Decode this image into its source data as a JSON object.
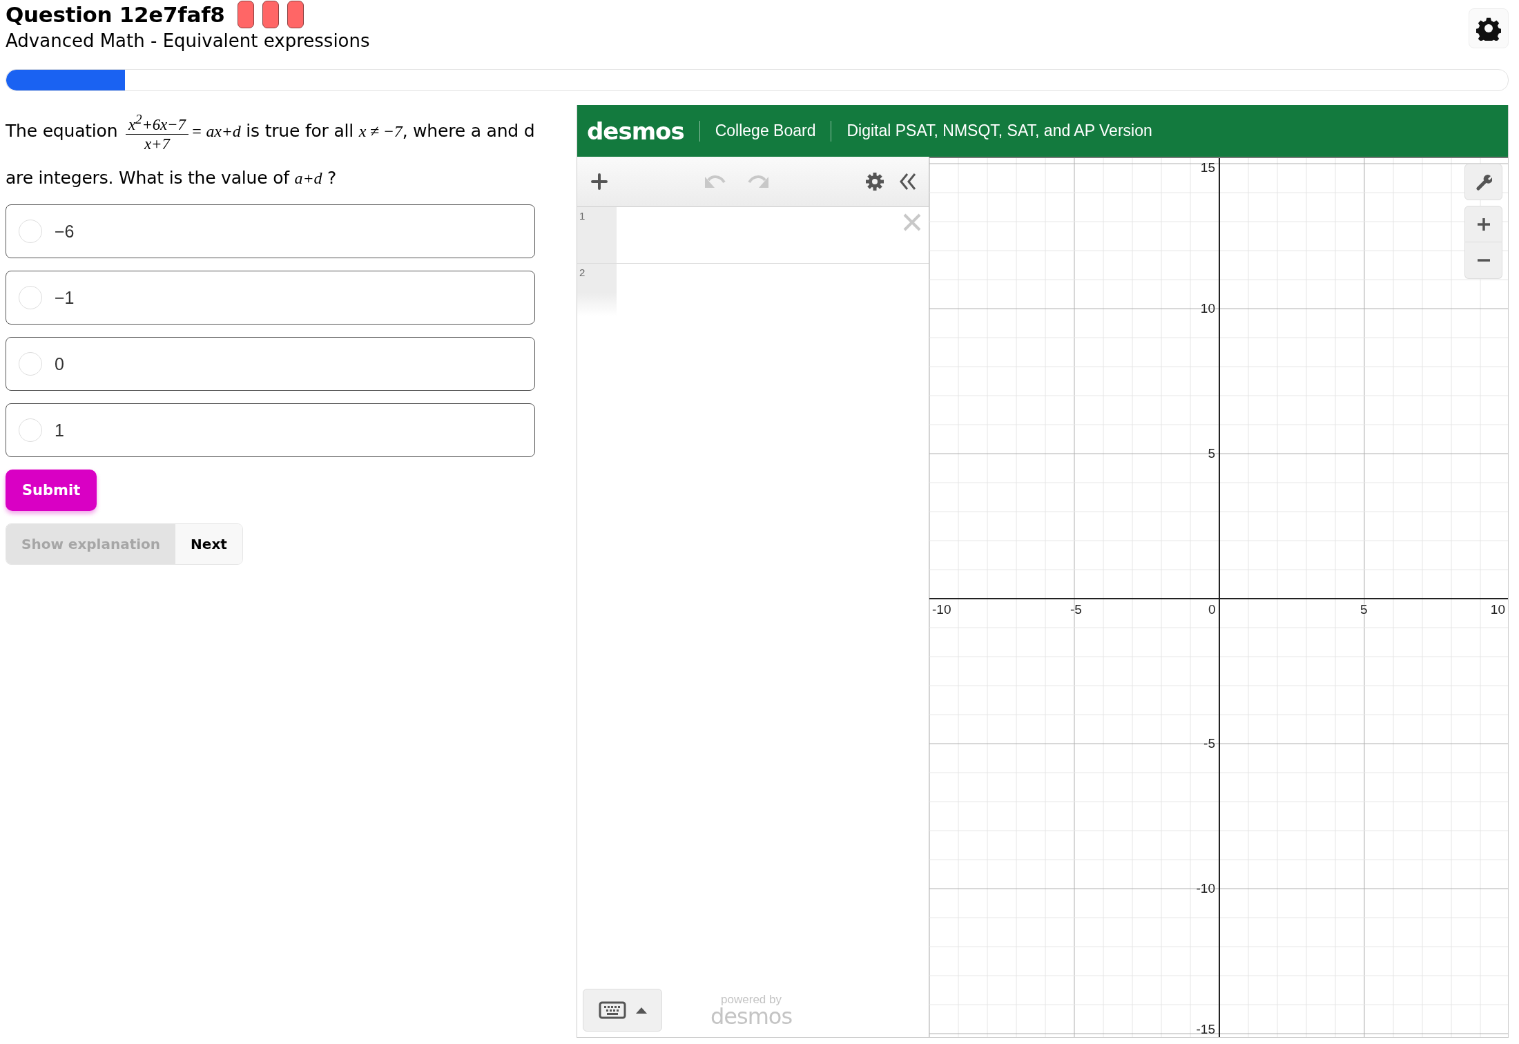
{
  "header": {
    "title": "Question 12e7faf8",
    "markers": [
      {
        "color": "#ff6666"
      },
      {
        "color": "#ff6666"
      },
      {
        "color": "#ff6666"
      }
    ],
    "subtitle": "Advanced Math - Equivalent expressions"
  },
  "progress": {
    "level": 0.079
  },
  "question": [
    {
      "kind": "text",
      "text": "The equation "
    },
    {
      "kind": "fraction",
      "numerator": "x$^{2}$+6x−7",
      "denominator": "x+7"
    },
    {
      "kind": "math",
      "text": "= ax+d"
    },
    {
      "kind": "text",
      "text": " is true for all "
    },
    {
      "kind": "math",
      "text": "x ≠ −7"
    },
    {
      "kind": "text",
      "text": ", where a and d are integers. What is the value of "
    },
    {
      "kind": "math",
      "text": "a+d"
    },
    {
      "kind": "text",
      "text": " ?"
    }
  ],
  "choices": [
    {
      "label": "−6",
      "selected": false
    },
    {
      "label": "−1",
      "selected": false
    },
    {
      "label": "0",
      "selected": false
    },
    {
      "label": "1",
      "selected": false
    }
  ],
  "submit_button": "Submit",
  "explanation_button": {
    "label": "Show explanation",
    "disabled": true
  },
  "next_button": {
    "label": "Next",
    "disabled": false
  },
  "calculator": {
    "logo": "desmos",
    "brand": "College Board",
    "version": "Digital PSAT, NMSQT, SAT, and AP Version",
    "expressions": [
      {
        "number": "1",
        "selected": true
      },
      {
        "number": "2",
        "selected": false
      }
    ],
    "powered_by": "powered by",
    "footer_logo": "desmos",
    "x_tick_labels": [
      "-10",
      "-5",
      "0",
      "5",
      "10"
    ],
    "y_tick_labels": [
      "15",
      "10",
      "5",
      "-5",
      "-10",
      "-15"
    ]
  }
}
